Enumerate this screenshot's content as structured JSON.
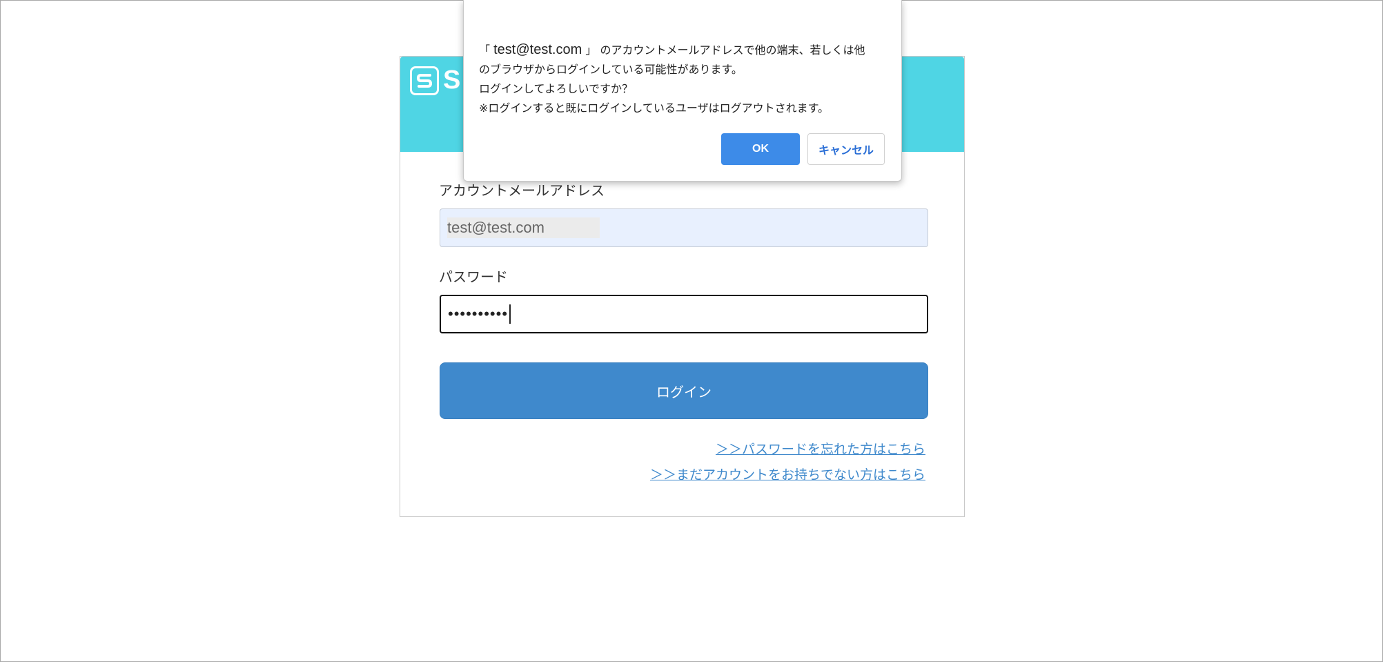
{
  "brand": {
    "logo_text": "S",
    "header_color": "#4fd5e4"
  },
  "login_form": {
    "email_label": "アカウントメールアドレス",
    "email_value": "test@test.com",
    "password_label": "パスワード",
    "password_masked": "••••••••••",
    "login_button": "ログイン",
    "forgot_link": "＞＞パスワードを忘れた方はこちら",
    "signup_link": "＞＞まだアカウントをお持ちでない方はこちら"
  },
  "dialog": {
    "quote_open": "「",
    "email": "test@test.com",
    "quote_close": "」",
    "line1_rest": "のアカウントメールアドレスで他の端末、若しくは他",
    "line2": "のブラウザからログインしている可能性があります。",
    "line3": "ログインしてよろしいですか？",
    "line4": "※ログインすると既にログインしているユーザはログアウトされます。",
    "ok_button": "OK",
    "cancel_button": "キャンセル"
  },
  "colors": {
    "primary": "#3f89cc",
    "dialog_ok": "#3d8be8",
    "autofill_bg": "#e8f0fe"
  }
}
